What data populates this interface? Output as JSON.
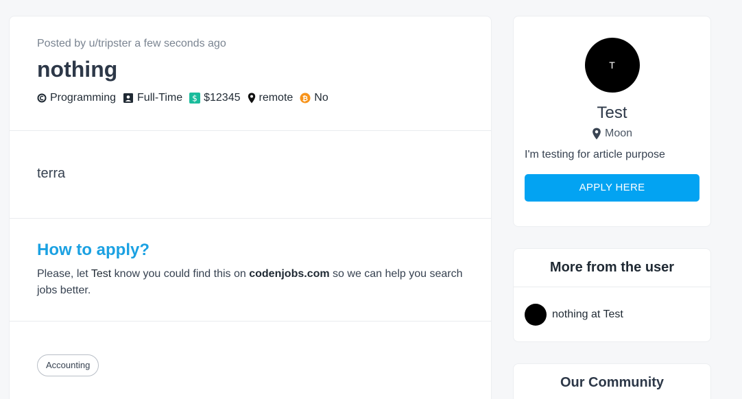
{
  "post": {
    "meta": "Posted by u/tripster a few seconds ago",
    "title": "nothing",
    "facts": {
      "category": "Programming",
      "type": "Full-Time",
      "salary": "$12345",
      "location": "remote",
      "crypto": "No"
    },
    "body": "terra",
    "how_to_apply": {
      "heading": "How to apply?",
      "text_before": "Please, let ",
      "company": "Test",
      "text_middle": " know you could find this on ",
      "site": "codenjobs.com",
      "text_after": " so we can help you search jobs better."
    },
    "tags": [
      "Accounting"
    ]
  },
  "profile": {
    "avatar_letter": "T",
    "name": "Test",
    "location": "Moon",
    "bio": "I'm testing for article purpose",
    "apply_label": "APPLY HERE"
  },
  "more": {
    "heading": "More from the user",
    "items": [
      {
        "label": "nothing at Test"
      }
    ]
  },
  "community": {
    "heading": "Our Community"
  },
  "colors": {
    "accent": "#03a3f2",
    "heading_blue": "#1ba1e2",
    "salary_green": "#1abc9c",
    "crypto_orange": "#f7931a"
  }
}
